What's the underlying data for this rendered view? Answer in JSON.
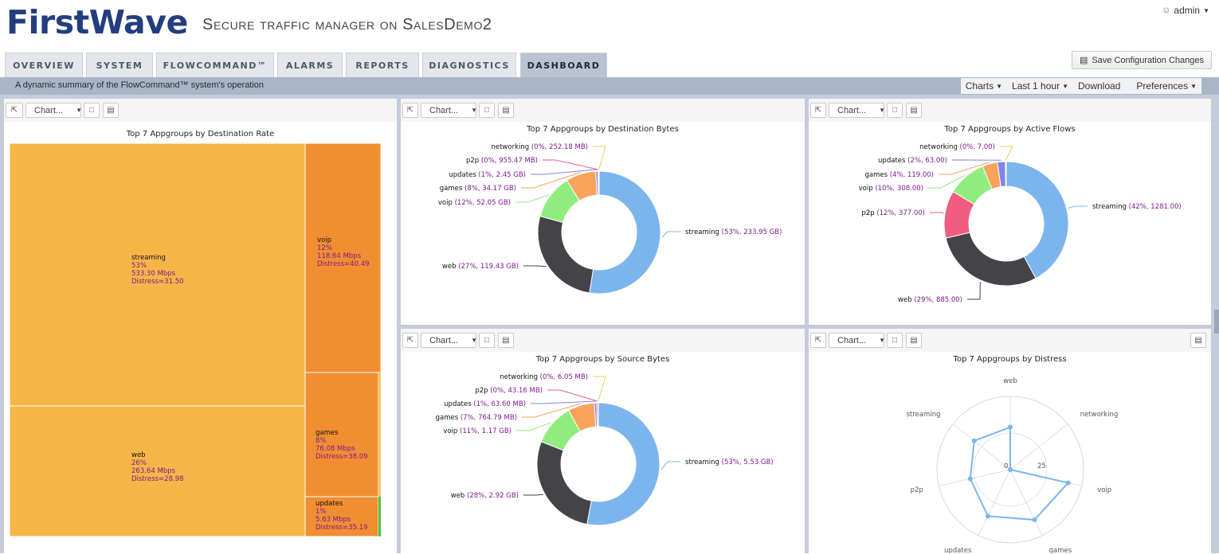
{
  "header": {
    "logo": "FirstWave",
    "title": "Secure traffic manager on SalesDemo2",
    "user": "admin"
  },
  "tabs": [
    "OVERVIEW",
    "SYSTEM",
    "FLOWCOMMAND™",
    "ALARMS",
    "REPORTS",
    "DIAGNOSTICS",
    "DASHBOARD"
  ],
  "active_tab": "DASHBOARD",
  "save_button": "Save Configuration Changes",
  "description": "A dynamic summary of the FlowCommand™ system's operation",
  "dashboard_controls": {
    "charts": "Charts",
    "range": "Last 1 hour",
    "download": "Download",
    "preferences": "Preferences"
  },
  "panel_toolbar": {
    "chart_select": "Chart..."
  },
  "colors": {
    "streaming": "#7cb5ec",
    "web": "#434348",
    "voip": "#90ed7d",
    "games": "#f7a35c",
    "updates": "#8085e9",
    "p2p": "#f15c80",
    "networking": "#e4d354",
    "treemap_a": "#f7b548",
    "treemap_b": "#f28e32",
    "label_value": "#7b1a8c"
  },
  "chart_data": [
    {
      "id": "treemap",
      "type": "treemap",
      "title": "Top 7 Appgroups by Destination Rate",
      "cells": [
        {
          "name": "streaming",
          "pct": "53%",
          "rate": "533.30 Mbps",
          "distress": "Distress=31.50"
        },
        {
          "name": "web",
          "pct": "26%",
          "rate": "263.64 Mbps",
          "distress": "Distress=28.98"
        },
        {
          "name": "voip",
          "pct": "12%",
          "rate": "118.64 Mbps",
          "distress": "Distress=40.49"
        },
        {
          "name": "games",
          "pct": "8%",
          "rate": "76.08 Mbps",
          "distress": "Distress=38.09"
        },
        {
          "name": "updates",
          "pct": "1%",
          "rate": "5.63 Mbps",
          "distress": "Distress=35.19"
        }
      ]
    },
    {
      "id": "dest_bytes",
      "type": "pie",
      "title": "Top 7 Appgroups by Destination Bytes",
      "slices": [
        {
          "name": "streaming",
          "value": 53,
          "label": "(53%, 233.95 GB)"
        },
        {
          "name": "web",
          "value": 27,
          "label": "(27%, 119.43 GB)"
        },
        {
          "name": "voip",
          "value": 12,
          "label": "(12%, 52.05 GB)"
        },
        {
          "name": "games",
          "value": 8,
          "label": "(8%, 34.17 GB)"
        },
        {
          "name": "updates",
          "value": 0.6,
          "label": "(1%, 2.45 GB)"
        },
        {
          "name": "p2p",
          "value": 0.2,
          "label": "(0%, 955.47 MB)"
        },
        {
          "name": "networking",
          "value": 0.1,
          "label": "(0%, 252.18 MB)"
        }
      ]
    },
    {
      "id": "active_flows",
      "type": "pie",
      "title": "Top 7 Appgroups by Active Flows",
      "slices": [
        {
          "name": "streaming",
          "value": 1281,
          "label": "(42%, 1281.00)"
        },
        {
          "name": "web",
          "value": 885,
          "label": "(29%, 885.00)"
        },
        {
          "name": "p2p",
          "value": 377,
          "label": "(12%, 377.00)"
        },
        {
          "name": "voip",
          "value": 308,
          "label": "(10%, 308.00)"
        },
        {
          "name": "games",
          "value": 119,
          "label": "(4%, 119.00)"
        },
        {
          "name": "updates",
          "value": 63,
          "label": "(2%, 63.00)"
        },
        {
          "name": "networking",
          "value": 7,
          "label": "(0%, 7.00)"
        }
      ]
    },
    {
      "id": "source_bytes",
      "type": "pie",
      "title": "Top 7 Appgroups by Source Bytes",
      "slices": [
        {
          "name": "streaming",
          "value": 53,
          "label": "(53%, 5.53 GB)"
        },
        {
          "name": "web",
          "value": 28,
          "label": "(28%, 2.92 GB)"
        },
        {
          "name": "voip",
          "value": 11,
          "label": "(11%, 1.17 GB)"
        },
        {
          "name": "games",
          "value": 7,
          "label": "(7%, 764.79 MB)"
        },
        {
          "name": "updates",
          "value": 0.6,
          "label": "(1%, 63.60 MB)"
        },
        {
          "name": "p2p",
          "value": 0.4,
          "label": "(0%, 43.16 MB)"
        },
        {
          "name": "networking",
          "value": 0.06,
          "label": "(0%, 6.05 MB)"
        }
      ]
    },
    {
      "id": "distress",
      "type": "polar",
      "title": "Top 7 Appgroups by Distress",
      "categories": [
        "web",
        "networking",
        "voip",
        "games",
        "updates",
        "p2p",
        "streaming"
      ],
      "values": [
        28.98,
        0,
        40.49,
        38.09,
        35.19,
        28,
        31.5
      ],
      "rmax": 50,
      "tick_labels": [
        "0",
        "25"
      ]
    }
  ]
}
